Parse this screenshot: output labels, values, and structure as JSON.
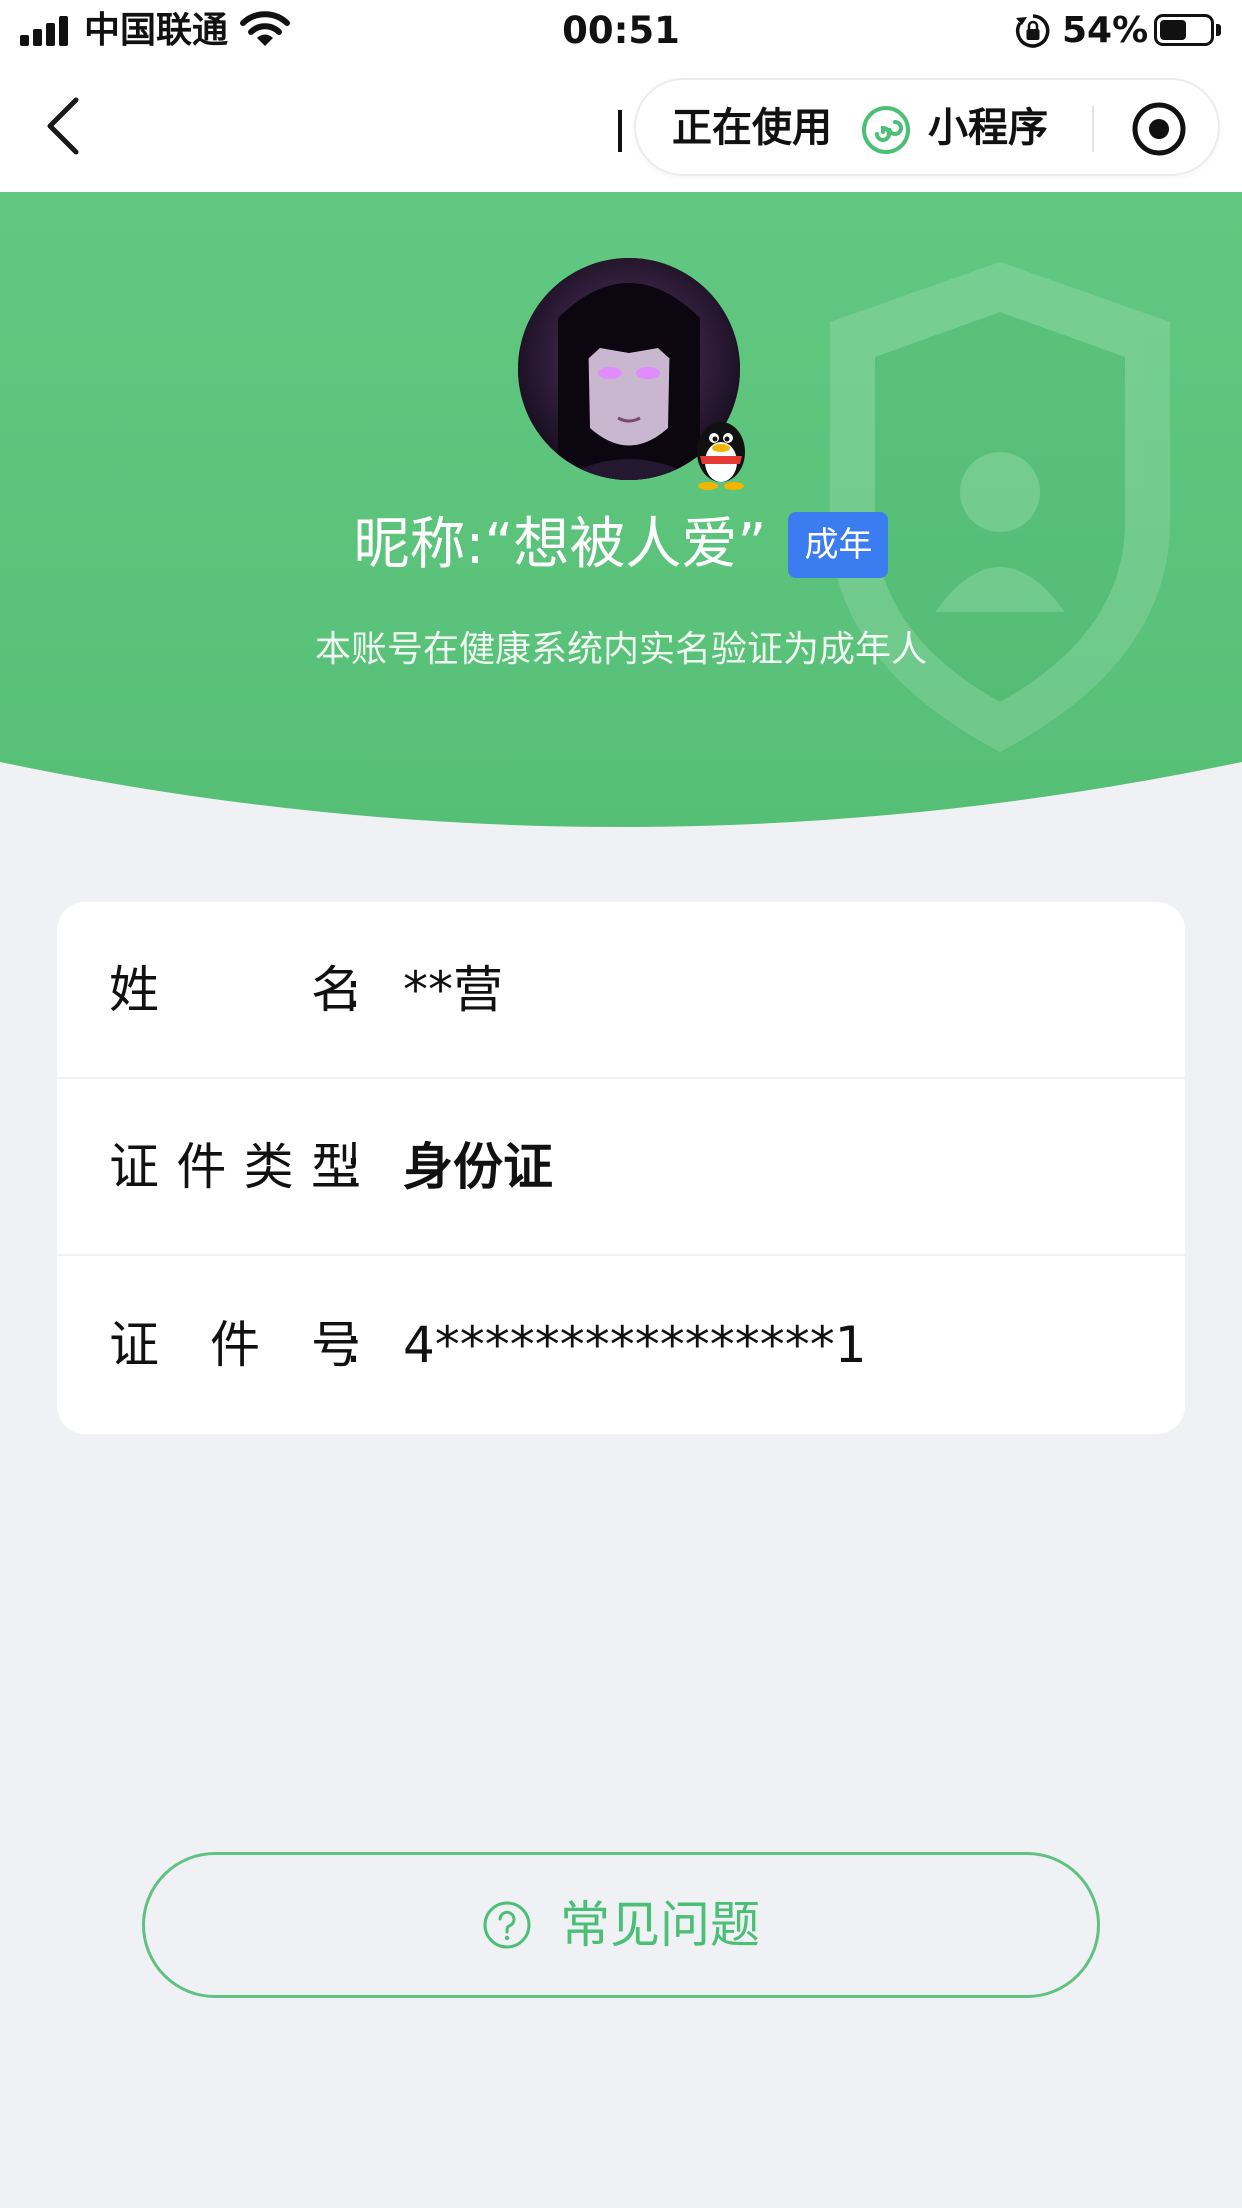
{
  "status_bar": {
    "carrier": "中国联通",
    "time": "00:51",
    "battery_percent": "54%",
    "battery_level": 0.54,
    "icons": [
      "signal-icon",
      "wifi-icon",
      "orientation-lock-icon",
      "battery-icon"
    ]
  },
  "nav": {
    "back_icon": "chevron-left-icon",
    "capsule": {
      "using_label": "正在使用",
      "mini_program_icon": "mini-program-link-icon",
      "mini_program_label": "小程序",
      "close_icon": "target-circle-icon"
    }
  },
  "profile": {
    "nickname": "昵称:“想被人爱”",
    "age_badge": "成年",
    "verify_note": "本账号在健康系统内实名验证为成年人",
    "badge_icon": "qq-penguin-icon"
  },
  "identity": {
    "rows": [
      {
        "label": "姓名",
        "colon": ":",
        "value": "**营"
      },
      {
        "label": "证件类型",
        "colon": ":",
        "value": "身份证"
      },
      {
        "label": "证件号",
        "colon": ":",
        "value": "4****************1"
      }
    ]
  },
  "faq": {
    "icon": "question-circle-icon",
    "label": "常见问题"
  },
  "colors": {
    "header_green": "#5cc47c",
    "badge_blue": "#3b7cf0",
    "faq_green": "#4bbf76",
    "page_bg": "#eff1f5"
  }
}
